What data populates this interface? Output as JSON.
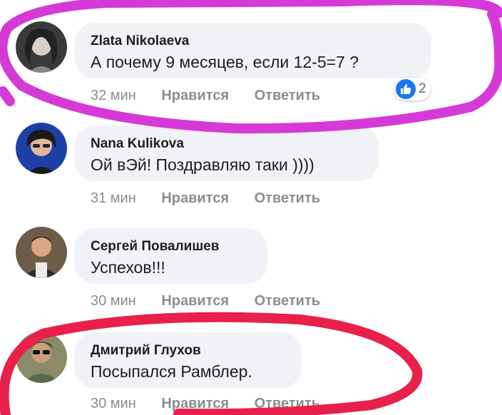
{
  "comments": [
    {
      "author": "Zlata Nikolaeva",
      "text": "А почему 9 месяцев, если 12-5=7 ?",
      "time": "32 мин",
      "like": "Нравится",
      "reply": "Ответить",
      "reactions": {
        "icon": "like-icon",
        "count": "2"
      }
    },
    {
      "author": "Nana Kulikova",
      "text": "Ой вЭй! Поздравляю таки ))))",
      "time": "31 мин",
      "like": "Нравится",
      "reply": "Ответить"
    },
    {
      "author": "Сергей Повалишев",
      "text": "Успехов!!!",
      "time": "30 мин",
      "like": "Нравится",
      "reply": "Ответить"
    },
    {
      "author": "Дмитрий Глухов",
      "text": "Посыпался Рамблер.",
      "time": "30 мин",
      "like": "Нравится",
      "reply": "Ответить"
    }
  ],
  "colors": {
    "bubble": "#f0f2f5",
    "like_blue": "#1877f2",
    "magenta_marker": "#d63ad6",
    "red_marker": "#e8204a",
    "meta_gray": "#8a8d91"
  }
}
